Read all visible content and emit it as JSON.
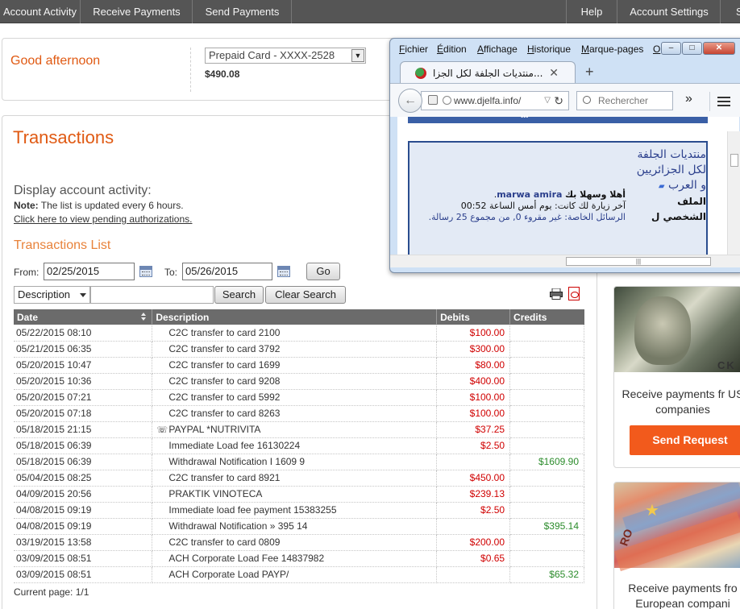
{
  "nav": {
    "left": [
      "Account Activity",
      "Receive Payments",
      "Send Payments"
    ],
    "right": [
      "Help",
      "Account Settings",
      "S"
    ]
  },
  "greeting": {
    "text": "Good afternoon",
    "card_select": "Prepaid Card - XXXX-2528",
    "balance": "$490.08"
  },
  "transactions": {
    "title": "Transactions",
    "display_label": "Display account activity:",
    "note_label": "Note:",
    "note_text": " The list is updated every 6 hours.",
    "pending_link": "Click here to view pending authorizations.",
    "list_title": "Transactions List",
    "from_label": "From:",
    "from_value": "02/25/2015",
    "to_label": "To:",
    "to_value": "05/26/2015",
    "go_label": "Go",
    "filter_select": "Description",
    "search_label": "Search",
    "clear_label": "Clear Search",
    "columns": [
      "Date",
      "Description",
      "Debits",
      "Credits"
    ],
    "rows": [
      {
        "date": "05/22/2015 08:10",
        "desc": "C2C transfer to card 2100",
        "debit": "$100.00",
        "credit": ""
      },
      {
        "date": "05/21/2015 06:35",
        "desc": "C2C transfer to card 3792",
        "debit": "$300.00",
        "credit": ""
      },
      {
        "date": "05/20/2015 10:47",
        "desc": "C2C transfer to card 1699",
        "debit": "$80.00",
        "credit": ""
      },
      {
        "date": "05/20/2015 10:36",
        "desc": "C2C transfer to card 9208",
        "debit": "$400.00",
        "credit": ""
      },
      {
        "date": "05/20/2015 07:21",
        "desc": "C2C transfer to card 5992",
        "debit": "$100.00",
        "credit": ""
      },
      {
        "date": "05/20/2015 07:18",
        "desc": "C2C transfer to card 8263",
        "debit": "$100.00",
        "credit": ""
      },
      {
        "date": "05/18/2015 21:15",
        "desc": "PAYPAL *NUTRIVITA",
        "debit": "$37.25",
        "credit": ""
      },
      {
        "date": "05/18/2015 06:39",
        "desc": "Immediate Load fee 16130224",
        "debit": "$2.50",
        "credit": ""
      },
      {
        "date": "05/18/2015 06:39",
        "desc": "Withdrawal Notification I                              1609 9",
        "debit": "",
        "credit": "$1609.90"
      },
      {
        "date": "05/04/2015 08:25",
        "desc": "C2C transfer to card 8921",
        "debit": "$450.00",
        "credit": ""
      },
      {
        "date": "04/09/2015 20:56",
        "desc": "PRAKTIK VINOTECA",
        "debit": "$239.13",
        "credit": ""
      },
      {
        "date": "04/08/2015 09:19",
        "desc": "Immediate load fee payment 15383255",
        "debit": "$2.50",
        "credit": ""
      },
      {
        "date": "04/08/2015 09:19",
        "desc": "Withdrawal Notification                          » 395 14",
        "debit": "",
        "credit": "$395.14"
      },
      {
        "date": "03/19/2015 13:58",
        "desc": "C2C transfer to card 0809",
        "debit": "$200.00",
        "credit": ""
      },
      {
        "date": "03/09/2015 08:51",
        "desc": "ACH Corporate Load Fee 14837982",
        "debit": "$0.65",
        "credit": ""
      },
      {
        "date": "03/09/2015 08:51",
        "desc": "ACH Corporate Load PAYP/",
        "debit": "",
        "credit": "$65.32"
      }
    ],
    "current_page": "Current page: 1/1"
  },
  "promo": {
    "card1_banknote_text": "CK",
    "card1_text": "Receive payments fr US companies",
    "send_request": "Send Request",
    "card2_banknote_text": "RO",
    "card2_text": "Receive payments fro European compani"
  },
  "firefox": {
    "menu": [
      "Fichier",
      "Édition",
      "Affichage",
      "Historique",
      "Marque-pages",
      "O"
    ],
    "menu_underline": [
      "F",
      "É",
      "A",
      "H",
      "M",
      "O"
    ],
    "tab_title": "منتديات الجلفة لكل الجزا...",
    "url": "www.djelfa.info/",
    "search_placeholder": "Rechercher",
    "site_title": "منتديات الجلفة لكل الجزائريين و العرب",
    "profile_link": "الملف الشخصي ل",
    "welcome_line": "أهلا وسهلا بك",
    "user_name": "marwa amira",
    "last_visit": "آخر زيارة لك كانت: يوم أمس الساعة 00:52",
    "private_messages": "الرسائل الخاصة: غير مقروء 0, من مجموع 25 رسالة.",
    "dots": "•••"
  },
  "colors": {
    "accent": "#e05a13",
    "nav_bg": "#555555",
    "debit": "#d00000",
    "credit": "#2c8c2c",
    "send_button": "#f25a1c"
  }
}
